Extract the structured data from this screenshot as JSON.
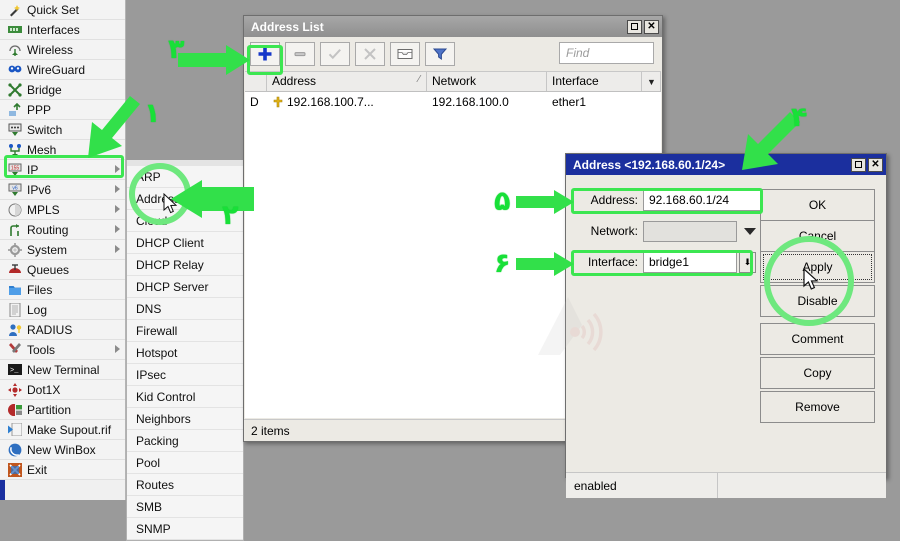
{
  "desktop": {
    "background": "#9a9a9a"
  },
  "winbox_menu": {
    "items": [
      {
        "label": "Quick Set",
        "icon": "wand-icon",
        "submenu": false
      },
      {
        "label": "Interfaces",
        "icon": "network-card-icon",
        "submenu": false
      },
      {
        "label": "Wireless",
        "icon": "antenna-icon",
        "submenu": false
      },
      {
        "label": "WireGuard",
        "icon": "wireguard-icon",
        "submenu": false
      },
      {
        "label": "Bridge",
        "icon": "bridge-icon",
        "submenu": false
      },
      {
        "label": "PPP",
        "icon": "ppp-icon",
        "submenu": false
      },
      {
        "label": "Switch",
        "icon": "switch-icon",
        "submenu": false
      },
      {
        "label": "Mesh",
        "icon": "mesh-icon",
        "submenu": false
      },
      {
        "label": "IP",
        "icon": "ip-icon",
        "submenu": true
      },
      {
        "label": "IPv6",
        "icon": "ipv6-icon",
        "submenu": true
      },
      {
        "label": "MPLS",
        "icon": "mpls-icon",
        "submenu": true
      },
      {
        "label": "Routing",
        "icon": "routing-icon",
        "submenu": true
      },
      {
        "label": "System",
        "icon": "gear-icon",
        "submenu": true
      },
      {
        "label": "Queues",
        "icon": "queues-icon",
        "submenu": false
      },
      {
        "label": "Files",
        "icon": "folder-icon",
        "submenu": false
      },
      {
        "label": "Log",
        "icon": "log-icon",
        "submenu": false
      },
      {
        "label": "RADIUS",
        "icon": "radius-icon",
        "submenu": false
      },
      {
        "label": "Tools",
        "icon": "tools-icon",
        "submenu": true
      },
      {
        "label": "New Terminal",
        "icon": "terminal-icon",
        "submenu": false
      },
      {
        "label": "Dot1X",
        "icon": "dot1x-icon",
        "submenu": false
      },
      {
        "label": "Partition",
        "icon": "partition-icon",
        "submenu": false
      },
      {
        "label": "Make Supout.rif",
        "icon": "supout-icon",
        "submenu": false
      },
      {
        "label": "New WinBox",
        "icon": "winbox-icon",
        "submenu": false
      },
      {
        "label": "Exit",
        "icon": "exit-icon",
        "submenu": false
      }
    ]
  },
  "ip_submenu": {
    "items": [
      {
        "label": "ARP"
      },
      {
        "label": "Addresses"
      },
      {
        "label": "Cloud"
      },
      {
        "label": "DHCP Client"
      },
      {
        "label": "DHCP Relay"
      },
      {
        "label": "DHCP Server"
      },
      {
        "label": "DNS"
      },
      {
        "label": "Firewall"
      },
      {
        "label": "Hotspot"
      },
      {
        "label": "IPsec"
      },
      {
        "label": "Kid Control"
      },
      {
        "label": "Neighbors"
      },
      {
        "label": "Packing"
      },
      {
        "label": "Pool"
      },
      {
        "label": "Routes"
      },
      {
        "label": "SMB"
      },
      {
        "label": "SNMP"
      }
    ]
  },
  "address_list_window": {
    "title": "Address List",
    "title_bar_buttons": {
      "maximize": "maximize-icon",
      "close": "close-icon"
    },
    "toolbar": {
      "add": "add-icon",
      "remove": "remove-icon",
      "enable": "enable-check-icon",
      "disable": "disable-cross-icon",
      "comment": "comment-icon",
      "filter": "filter-icon",
      "find_placeholder": "Find",
      "find_value": ""
    },
    "table": {
      "columns": [
        "",
        "Address",
        "Network",
        "Interface",
        ""
      ],
      "sort_column": "Address",
      "rows": [
        {
          "flags": "D",
          "address": "192.168.100.7...",
          "network": "192.168.100.0",
          "interface": "ether1"
        }
      ]
    },
    "status": "2 items"
  },
  "address_dialog": {
    "title": "Address <192.168.60.1/24>",
    "title_bar_buttons": {
      "maximize": "maximize-icon",
      "close": "close-icon"
    },
    "fields": {
      "address_label": "Address:",
      "address_value": "92.168.60.1/24",
      "network_label": "Network:",
      "network_value": "",
      "interface_label": "Interface:",
      "interface_value": "bridge1"
    },
    "buttons": [
      {
        "label": "OK",
        "focused": false
      },
      {
        "label": "Cancel",
        "focused": false
      },
      {
        "label": "Apply",
        "focused": true
      },
      {
        "label": "Disable",
        "focused": false
      },
      {
        "label": "Comment",
        "focused": false
      },
      {
        "label": "Copy",
        "focused": false
      },
      {
        "label": "Remove",
        "focused": false
      }
    ],
    "status": "enabled"
  },
  "annotations": {
    "accent_color": "#3ce651",
    "steps": [
      {
        "number": "۱",
        "target": "sidebar-item-ip"
      },
      {
        "number": "۲",
        "target": "ip-submenu-addresses"
      },
      {
        "number": "۳",
        "target": "address-list-add-button"
      },
      {
        "number": "۴",
        "target": "address-dialog-titlebar"
      },
      {
        "number": "۵",
        "target": "address-field"
      },
      {
        "number": "۶",
        "target": "interface-field"
      }
    ]
  }
}
